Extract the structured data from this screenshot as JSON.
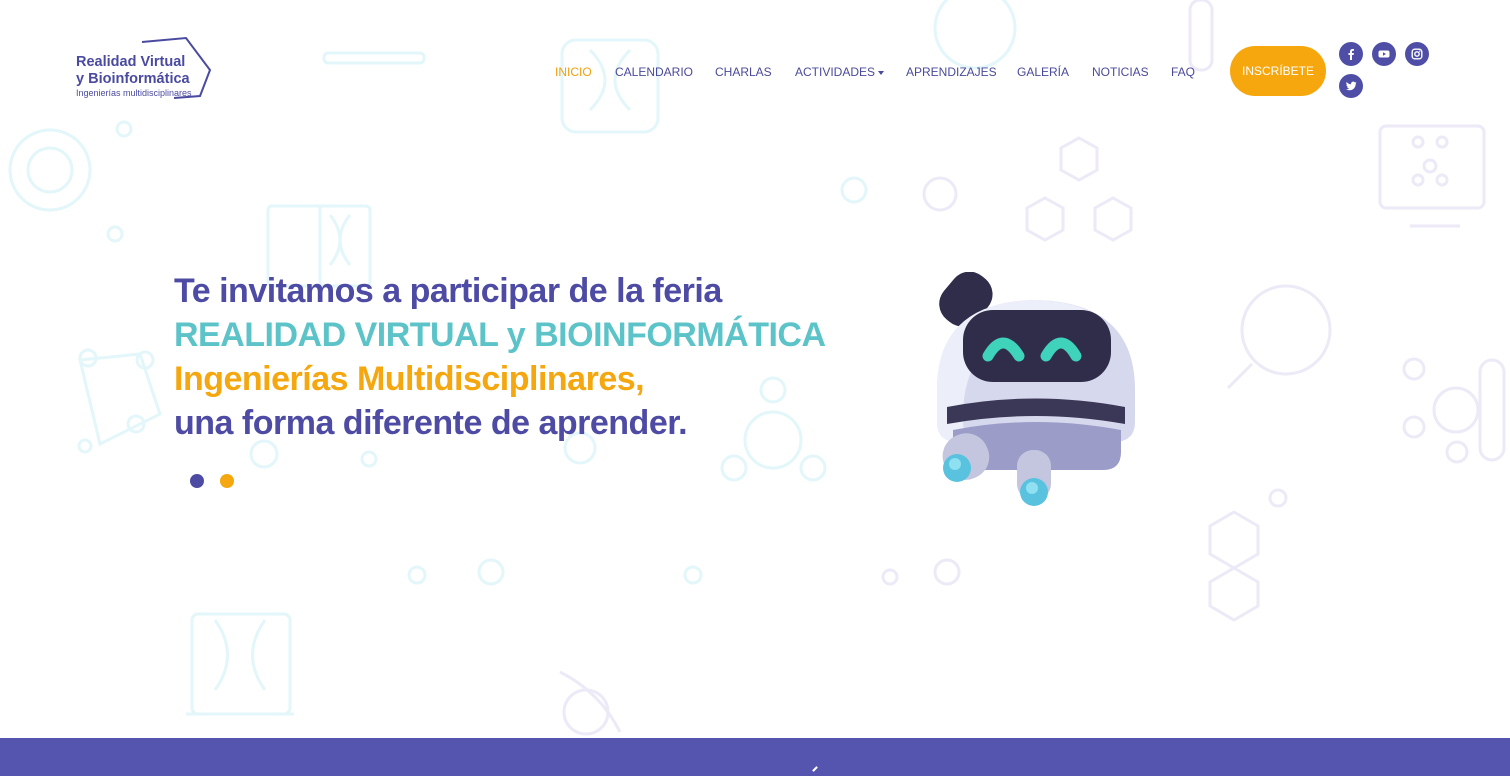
{
  "brand": {
    "line1": "Realidad Virtual",
    "line2": "y Bioinformática",
    "tagline": "Ingenierías multidisciplinares"
  },
  "nav": {
    "items": [
      {
        "label": "INICIO",
        "active": true
      },
      {
        "label": "CALENDARIO"
      },
      {
        "label": "CHARLAS"
      },
      {
        "label": "ACTIVIDADES",
        "dropdown": true
      },
      {
        "label": "APRENDIZAJES"
      },
      {
        "label": "GALERÍA"
      },
      {
        "label": "NOTICIAS"
      },
      {
        "label": "FAQ"
      }
    ],
    "cta_label": "INSCRÍBETE"
  },
  "social": [
    {
      "icon": "facebook-icon"
    },
    {
      "icon": "youtube-icon"
    },
    {
      "icon": "instagram-icon"
    },
    {
      "icon": "twitter-icon"
    }
  ],
  "hero": {
    "line1": "Te invitamos a participar de la feria",
    "line2": "REALIDAD VIRTUAL y BIOINFORMÁTICA",
    "line3": "Ingenierías Multidisciplinares,",
    "line4": "una forma diferente de aprender.",
    "slides": 2,
    "illustration": "robot-mascot"
  },
  "colors": {
    "primary": "#4d4ba3",
    "teal": "#5cc4c9",
    "accent": "#f4a70f",
    "band": "#5555b0"
  }
}
